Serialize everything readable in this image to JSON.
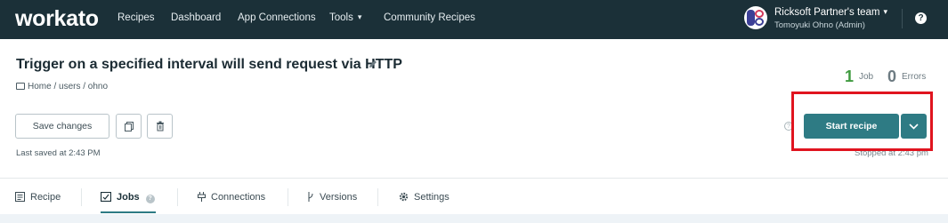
{
  "brand": {
    "logo": "workato"
  },
  "nav": {
    "items": [
      {
        "label": "Recipes"
      },
      {
        "label": "Dashboard"
      },
      {
        "label": "App Connections"
      },
      {
        "label": "Tools"
      },
      {
        "label": "Community Recipes"
      }
    ],
    "tools_chevron": "⌄"
  },
  "account": {
    "team": "Ricksoft Partner's team",
    "user": "Tomoyuki Ohno (Admin)"
  },
  "recipe": {
    "title": "Trigger on a specified interval will send request via HTTP",
    "breadcrumb": "Home / users / ohno"
  },
  "stats": {
    "jobs_count": "1",
    "jobs_label": "Job",
    "errors_count": "0",
    "errors_label": "Errors"
  },
  "actions": {
    "save_label": "Save changes",
    "last_saved": "Last saved at 2:43 PM",
    "start_label": "Start recipe",
    "stopped": "Stopped at 2:43 pm"
  },
  "tabs": [
    {
      "label": "Recipe"
    },
    {
      "label": "Jobs"
    },
    {
      "label": "Connections"
    },
    {
      "label": "Versions"
    },
    {
      "label": "Settings"
    }
  ],
  "colors": {
    "nav_bg": "#1b3038",
    "accent": "#2e7b84",
    "jobs_green": "#3f9a3f",
    "errors_gray": "#6d7b82",
    "highlight": "#e0141f"
  }
}
